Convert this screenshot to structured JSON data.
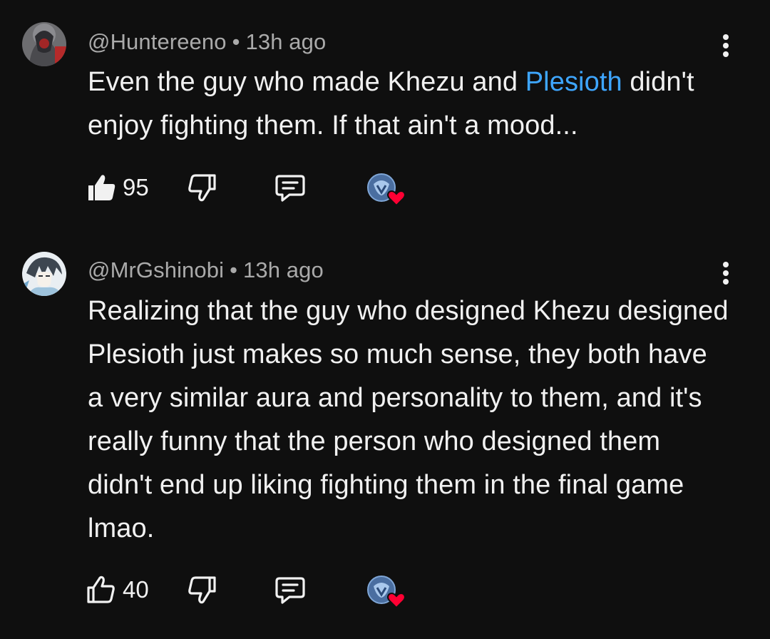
{
  "comments": [
    {
      "author": "@Huntereeno",
      "separator": "•",
      "time": "13h ago",
      "text_before": "Even the guy who made Khezu and ",
      "link_text": "Plesioth",
      "text_after": " didn't enjoy fighting them. If that ain't a mood...",
      "like_count": "95",
      "liked": true
    },
    {
      "author": "@MrGshinobi",
      "separator": "•",
      "time": "13h ago",
      "text": "Realizing that the guy who designed Khezu designed Plesioth just makes so much sense, they both have a very similar aura and personality to them, and it's really funny that the person who designed them didn't end up liking fighting them in the final game lmao.",
      "like_count": "40",
      "liked": false
    }
  ],
  "icons": {
    "like": "thumbs-up-icon",
    "dislike": "thumbs-down-icon",
    "reply": "comment-reply-icon",
    "menu": "more-vertical-icon",
    "creator_heart": "creator-heart-icon"
  },
  "colors": {
    "background": "#0f0f0f",
    "text": "#f1f1f1",
    "meta": "#aaaaaa",
    "link": "#3ea6ff",
    "heart": "#ff0033"
  }
}
